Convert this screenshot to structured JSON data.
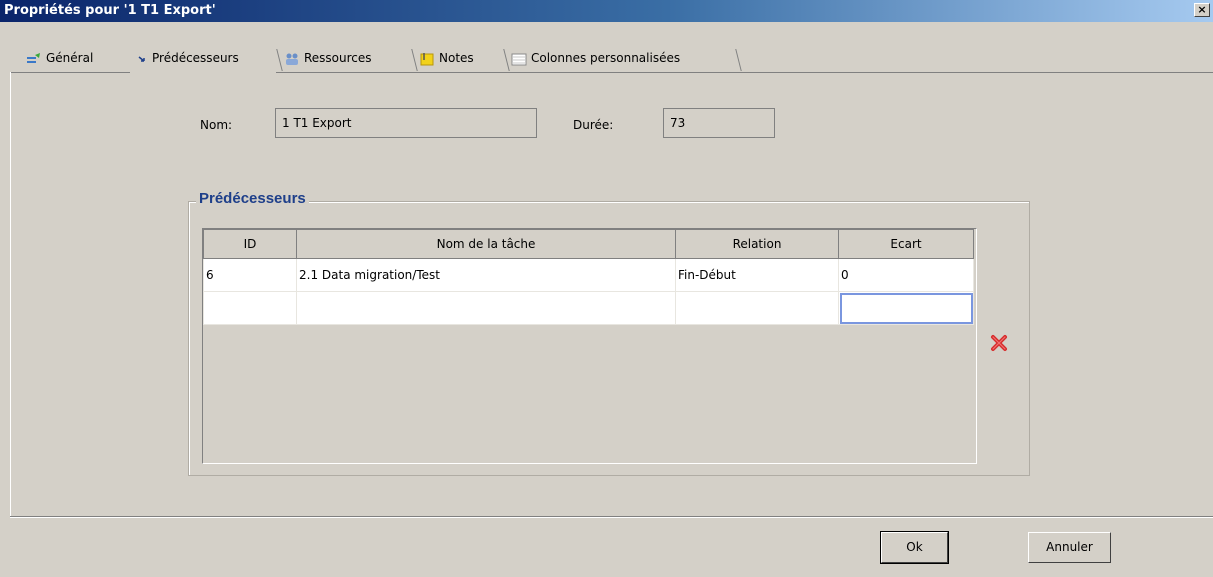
{
  "window": {
    "title": "Propriétés pour '1 T1 Export'",
    "close_glyph": "×"
  },
  "tabs": [
    {
      "label": "Général",
      "icon": "general-icon"
    },
    {
      "label": "Prédécesseurs",
      "icon": "predecessor-arrow-icon",
      "active": true
    },
    {
      "label": "Ressources",
      "icon": "resources-icon"
    },
    {
      "label": "Notes",
      "icon": "notes-icon"
    },
    {
      "label": "Colonnes personnalisées",
      "icon": "columns-icon"
    }
  ],
  "task": {
    "name_label": "Nom:",
    "name_value": "1 T1 Export",
    "duration_label": "Durée:",
    "duration_value": "73"
  },
  "predecessors": {
    "title": "Prédécesseurs",
    "columns": [
      "ID",
      "Nom de la tâche",
      "Relation",
      "Ecart"
    ],
    "rows": [
      {
        "id": "6",
        "name": "2.1 Data migration/Test",
        "relation": "Fin-Début",
        "lag": "0"
      },
      {
        "id": "",
        "name": "",
        "relation": "",
        "lag": ""
      }
    ],
    "delete_icon": "delete-x-icon",
    "delete_color": "#d62b2b"
  },
  "buttons": {
    "ok": "Ok",
    "cancel": "Annuler"
  }
}
